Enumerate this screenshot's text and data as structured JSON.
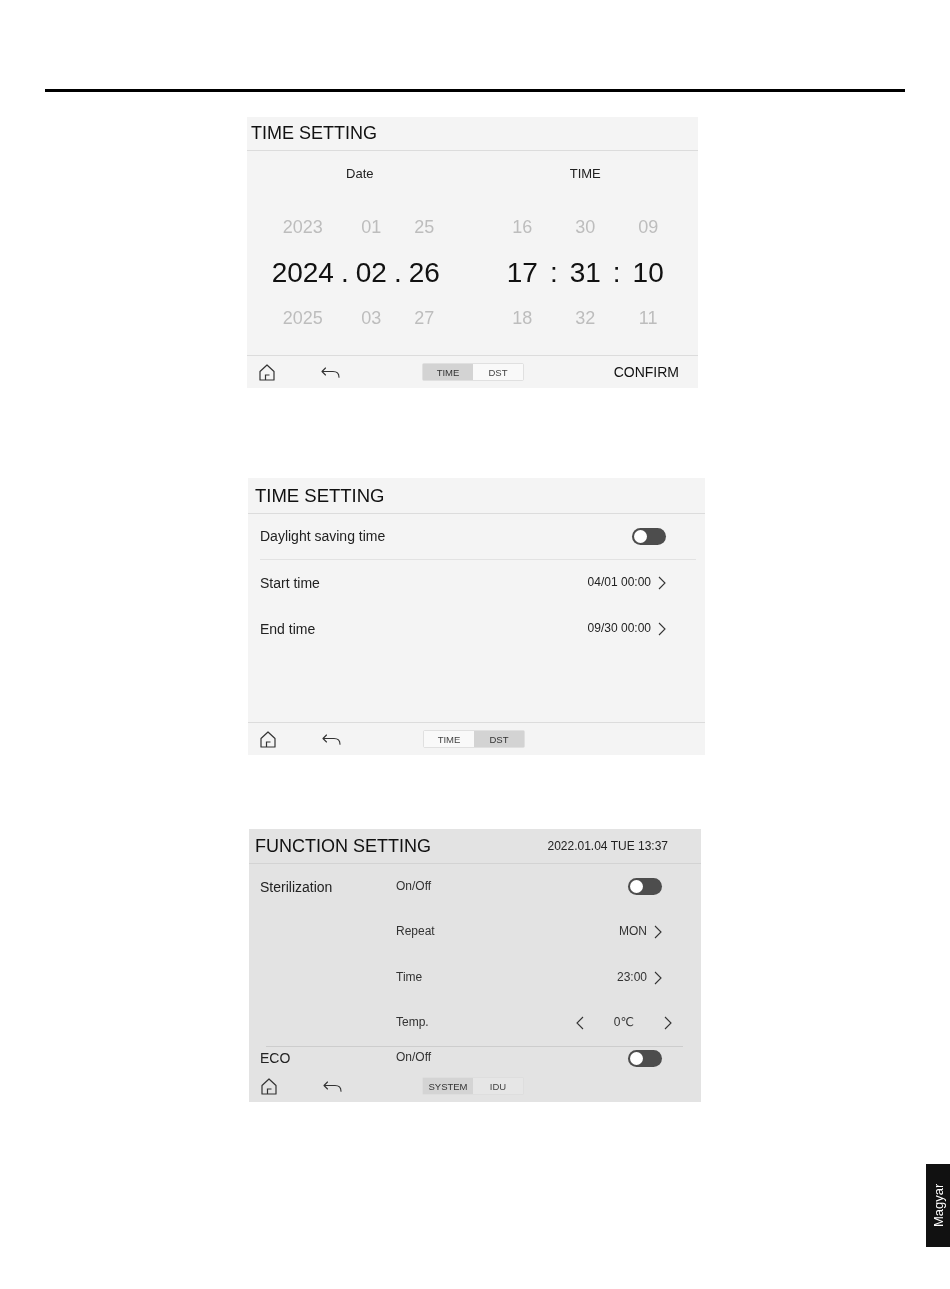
{
  "time_screen": {
    "title": "TIME SETTING",
    "date_picker": {
      "heading": "Date",
      "columns": [
        {
          "previous": "2023",
          "current": "2024",
          "next": "2025"
        },
        {
          "separator": ".",
          "previous": "01",
          "current": "02",
          "next": "03"
        },
        {
          "separator": ".",
          "previous": "25",
          "current": "26",
          "next": "27"
        }
      ]
    },
    "time_picker": {
      "heading": "TIME",
      "columns": [
        {
          "previous": "16",
          "current": "17",
          "next": "18"
        },
        {
          "separator": ":",
          "previous": "30",
          "current": "31",
          "next": "32"
        },
        {
          "separator": ":",
          "previous": "09",
          "current": "10",
          "next": "11"
        }
      ]
    },
    "footer": {
      "tabs": [
        {
          "label": "TIME",
          "selected": true
        },
        {
          "label": "DST",
          "selected": false
        }
      ],
      "confirm": "CONFIRM"
    }
  },
  "dst_screen": {
    "title": "TIME SETTING",
    "rows": [
      {
        "kind": "toggle",
        "label": "Daylight saving time",
        "on": false
      },
      {
        "kind": "link",
        "label": "Start time",
        "value": "04/01 00:00"
      },
      {
        "kind": "link",
        "label": "End time",
        "value": "09/30 00:00"
      }
    ],
    "footer": {
      "tabs": [
        {
          "label": "TIME",
          "selected": false
        },
        {
          "label": "DST",
          "selected": true
        }
      ]
    }
  },
  "function_screen": {
    "title": "FUNCTION SETTING",
    "datetime": "2022.01.04 TUE 13:37",
    "groups": [
      {
        "name": "Sterilization",
        "rows": [
          {
            "kind": "toggle",
            "label": "On/Off",
            "on": false
          },
          {
            "kind": "link",
            "label": "Repeat",
            "value": "MON"
          },
          {
            "kind": "link",
            "label": "Time",
            "value": "23:00"
          },
          {
            "kind": "stepper",
            "label": "Temp.",
            "value": "0℃"
          }
        ]
      },
      {
        "name": "ECO",
        "rows": [
          {
            "kind": "toggle",
            "label": "On/Off",
            "on": false
          }
        ]
      }
    ],
    "footer": {
      "tabs": [
        {
          "label": "SYSTEM",
          "selected": true
        },
        {
          "label": "IDU",
          "selected": false
        }
      ]
    }
  },
  "side_tab": {
    "label": "Magyar"
  }
}
